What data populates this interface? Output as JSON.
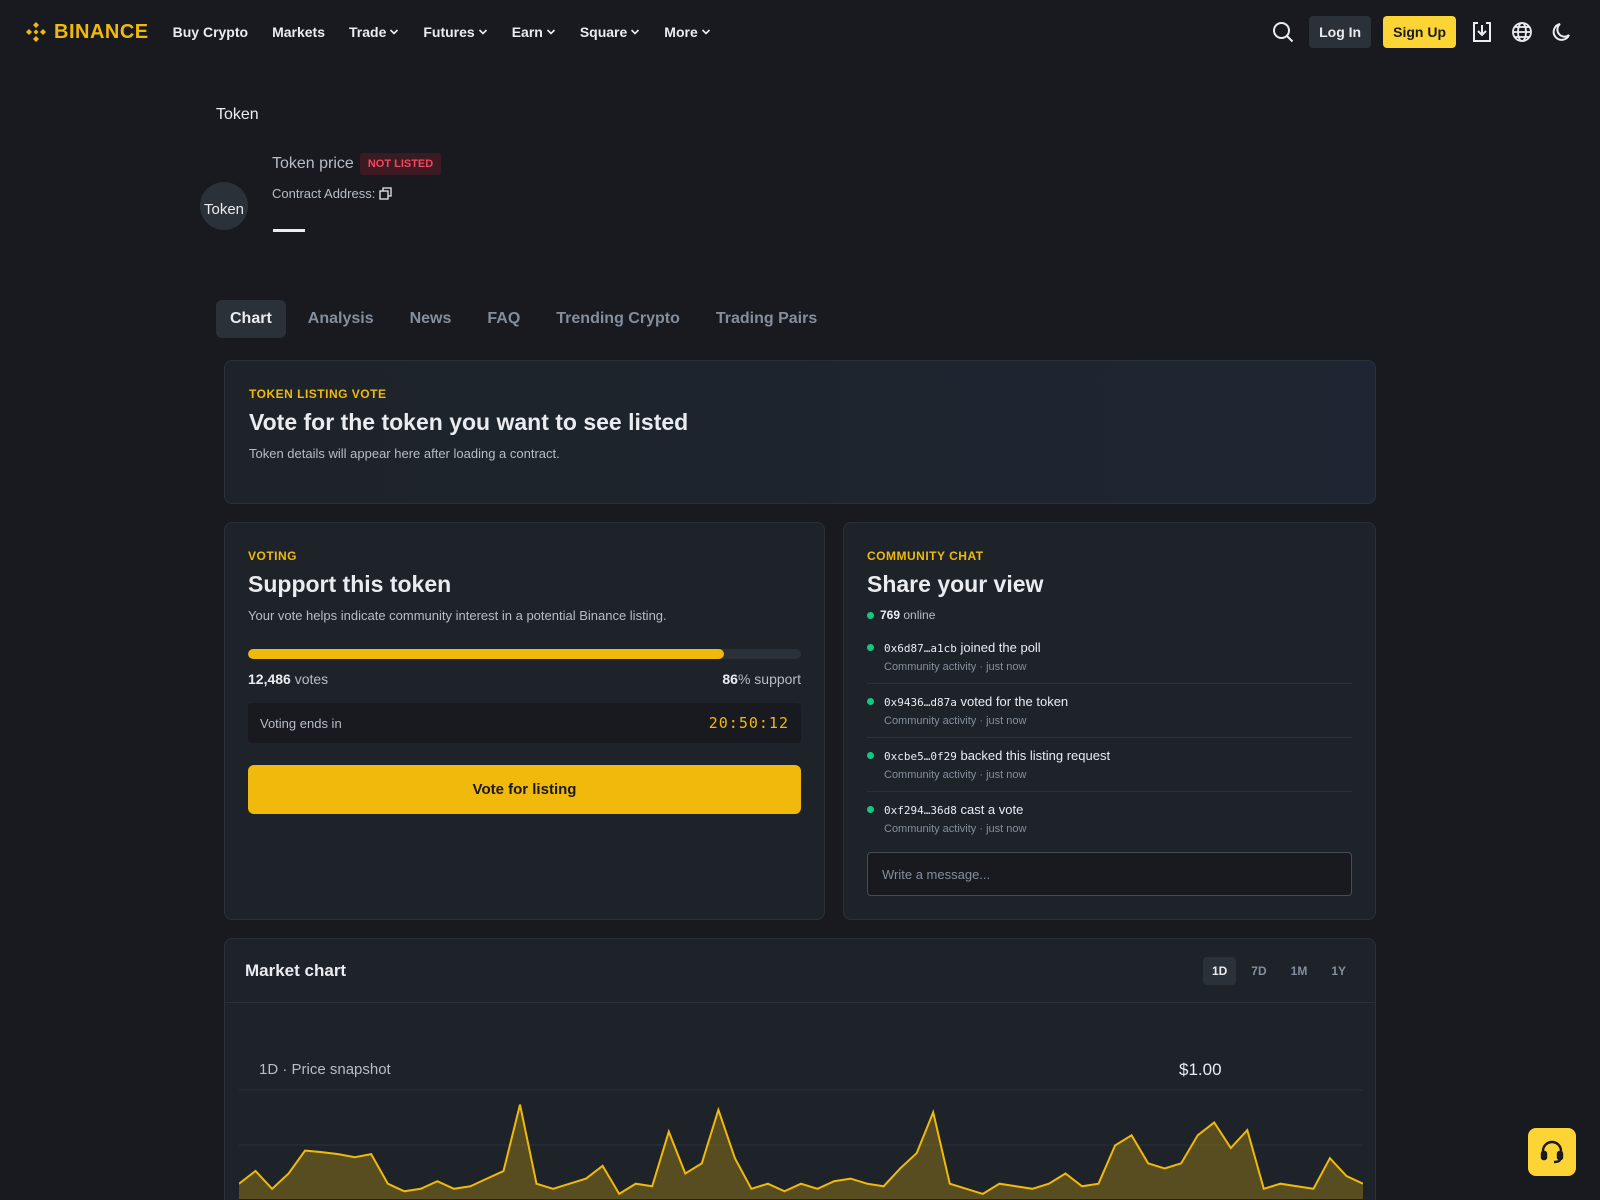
{
  "brand": {
    "name": "BINANCE",
    "color": "#f0b90b"
  },
  "nav": {
    "items": [
      {
        "label": "Buy Crypto",
        "dropdown": false
      },
      {
        "label": "Markets",
        "dropdown": false
      },
      {
        "label": "Trade",
        "dropdown": true
      },
      {
        "label": "Futures",
        "dropdown": true
      },
      {
        "label": "Earn",
        "dropdown": true
      },
      {
        "label": "Square",
        "dropdown": true
      },
      {
        "label": "More",
        "dropdown": true
      }
    ],
    "login_label": "Log In",
    "signup_label": "Sign Up",
    "icons": [
      "search-icon",
      "download-icon",
      "globe-icon",
      "moon-icon"
    ]
  },
  "token": {
    "breadcrumb": "Token",
    "avatar_alt": "Token",
    "name": "Token price",
    "badge": "NOT LISTED",
    "contract_label": "Contract Address:"
  },
  "tabs": [
    "Chart",
    "Analysis",
    "News",
    "FAQ",
    "Trending Crypto",
    "Trading Pairs"
  ],
  "hero": {
    "eyebrow": "TOKEN LISTING VOTE",
    "title": "Vote for the token you want to see listed",
    "subtitle": "Token details will appear here after loading a contract."
  },
  "voting": {
    "eyebrow": "VOTING",
    "title": "Support this token",
    "subtitle": "Your vote helps indicate community interest in a potential Binance listing.",
    "progress": 0.86,
    "votes_count": "12,486",
    "votes_label": "votes",
    "support_pct": "86",
    "support_label": "% support",
    "timer_label": "Voting ends in",
    "timer_value": "20:50:12",
    "button_label": "Vote for listing"
  },
  "chat": {
    "eyebrow": "COMMUNITY CHAT",
    "title": "Share your view",
    "online_count": "769",
    "online_label": "online",
    "messages": [
      {
        "addr": "0x6d87…a1cb",
        "text": " joined the poll",
        "meta": "Community activity · just now"
      },
      {
        "addr": "0x9436…d87a",
        "text": " voted for the token",
        "meta": "Community activity · just now"
      },
      {
        "addr": "0xcbe5…0f29",
        "text": " backed this listing request",
        "meta": "Community activity · just now"
      },
      {
        "addr": "0xf294…36d8",
        "text": " cast a vote",
        "meta": "Community activity · just now"
      }
    ],
    "input_placeholder": "Write a message..."
  },
  "market": {
    "title": "Market chart",
    "ranges": [
      "1D",
      "7D",
      "1M",
      "1Y"
    ],
    "active_range": "1D",
    "snapshot_label": "1D · Price snapshot",
    "price": "$1.00"
  },
  "chart_data": {
    "type": "area",
    "series": [
      {
        "values": [
          0.3,
          0.55,
          0.2,
          0.5,
          0.95,
          0.92,
          0.88,
          0.82,
          0.88,
          0.3,
          0.15,
          0.2,
          0.35,
          0.2,
          0.25,
          0.4,
          0.55,
          1.85,
          0.3,
          0.2,
          0.3,
          0.4,
          0.65,
          0.1,
          0.3,
          0.25,
          1.32,
          0.5,
          0.7,
          1.75,
          0.8,
          0.2,
          0.3,
          0.15,
          0.3,
          0.2,
          0.35,
          0.4,
          0.3,
          0.25,
          0.6,
          0.9,
          1.7,
          0.3,
          0.2,
          0.1,
          0.3,
          0.25,
          0.2,
          0.3,
          0.5,
          0.25,
          0.3,
          1.05,
          1.25,
          0.7,
          0.6,
          0.7,
          1.25,
          1.5,
          1.0,
          1.35,
          0.2,
          0.3,
          0.25,
          0.2,
          0.8,
          0.45,
          0.3
        ]
      }
    ],
    "color": "#f0b90b",
    "grid": true
  },
  "support": {
    "icon": "headset-icon",
    "color": "#fcd535"
  }
}
